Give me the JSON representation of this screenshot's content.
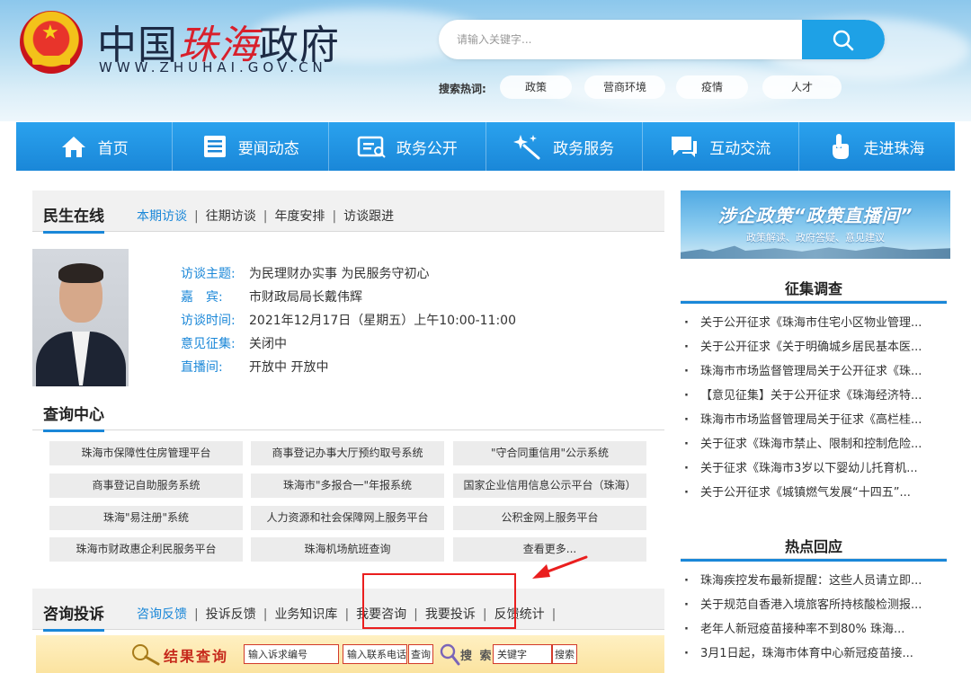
{
  "header": {
    "logo_cn_prefix": "中国",
    "logo_cn_red": "珠海",
    "logo_cn_suffix": "政府",
    "logo_url": "WWW.ZHUHAI.GOV.CN",
    "search_placeholder": "请输入关键字...",
    "hot_label": "搜索热词:",
    "hot_tags": [
      "政策",
      "营商环境",
      "疫情",
      "人才"
    ]
  },
  "nav": {
    "items": [
      {
        "label": "首页",
        "icon": "home-icon"
      },
      {
        "label": "要闻动态",
        "icon": "news-list-icon"
      },
      {
        "label": "政务公开",
        "icon": "public-info-icon"
      },
      {
        "label": "政务服务",
        "icon": "service-sparkle-icon"
      },
      {
        "label": "互动交流",
        "icon": "chat-icon"
      },
      {
        "label": "走进珠海",
        "icon": "pointer-hand-icon"
      }
    ]
  },
  "minsheng": {
    "title": "民生在线",
    "tabs": [
      "本期访谈",
      "往期访谈",
      "年度安排",
      "访谈跟进"
    ],
    "info": [
      {
        "k": "访谈主题:",
        "v": "为民理财办实事 为民服务守初心"
      },
      {
        "k": "嘉　宾:",
        "v": "市财政局局长戴伟辉"
      },
      {
        "k": "访谈时间:",
        "v": "2021年12月17日（星期五）上午10:00-11:00"
      },
      {
        "k": "意见征集:",
        "v": "关闭中"
      },
      {
        "k": "直播间:",
        "v": "开放中 开放中"
      }
    ]
  },
  "query": {
    "title": "查询中心",
    "items": [
      "珠海市保障性住房管理平台",
      "商事登记办事大厅预约取号系统",
      "\"守合同重信用\"公示系统",
      "商事登记自助服务系统",
      "珠海市\"多报合一\"年报系统",
      "国家企业信用信息公示平台（珠海）",
      "珠海\"易注册\"系统",
      "人力资源和社会保障网上服务平台",
      "公积金网上服务平台",
      "珠海市财政惠企利民服务平台",
      "珠海机场航班查询",
      "查看更多..."
    ]
  },
  "complaint": {
    "title": "咨询投诉",
    "tabs": [
      "咨询反馈",
      "投诉反馈",
      "业务知识库",
      "我要咨询",
      "我要投诉",
      "反馈统计"
    ],
    "trailing_sep": "|",
    "result_label": "结果查询",
    "input1": "输入诉求编号",
    "input2": "输入联系电话",
    "query_btn": "查询",
    "search_label": "搜 索",
    "keyword": "关键字",
    "search_btn": "搜索"
  },
  "banner": {
    "line1": "涉企政策“政策直播间”",
    "line2": "政策解读、政府答疑、意见建议"
  },
  "survey": {
    "title": "征集调查",
    "items": [
      "关于公开征求《珠海市住宅小区物业管理...",
      "关于公开征求《关于明确城乡居民基本医...",
      "珠海市市场监督管理局关于公开征求《珠...",
      "【意见征集】关于公开征求《珠海经济特...",
      "珠海市市场监督管理局关于征求《高栏桂...",
      "关于征求《珠海市禁止、限制和控制危险...",
      "关于征求《珠海市3岁以下婴幼儿托育机...",
      "关于公开征求《城镇燃气发展“十四五”..."
    ]
  },
  "hot": {
    "title": "热点回应",
    "items": [
      "珠海疾控发布最新提醒：这些人员请立即...",
      "关于规范自香港入境旅客所持核酸检测报...",
      "老年人新冠疫苗接种率不到80% 珠海...",
      "3月1日起，珠海市体育中心新冠疫苗接..."
    ]
  }
}
